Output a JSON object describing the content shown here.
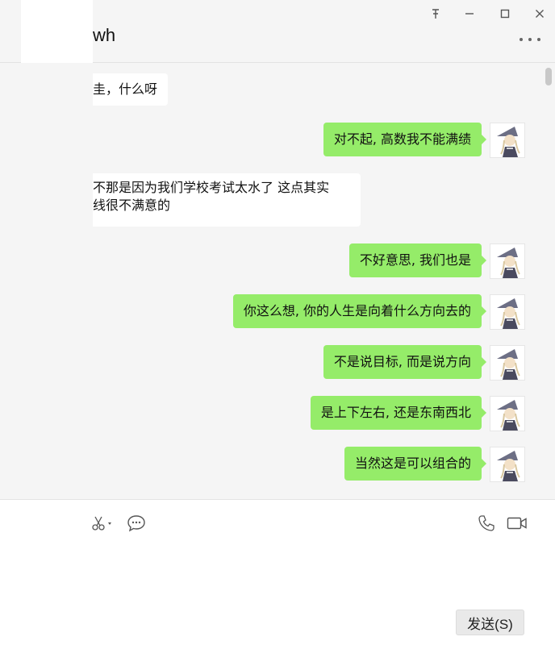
{
  "window": {
    "title": "wh",
    "controls": [
      "pin-icon",
      "minimize-icon",
      "maximize-icon",
      "close-icon"
    ]
  },
  "messages": [
    {
      "side": "in",
      "text": "圭，什么呀"
    },
    {
      "side": "out",
      "text": "对不起, 高数我不能满绩"
    },
    {
      "side": "in",
      "line1": "不那是因为我们学校考试太水了 这点其实",
      "line2": "线很不满意的"
    },
    {
      "side": "out",
      "text": "不好意思, 我们也是"
    },
    {
      "side": "out",
      "text": "你这么想, 你的人生是向着什么方向去的"
    },
    {
      "side": "out",
      "text": "不是说目标, 而是说方向"
    },
    {
      "side": "out",
      "text": "是上下左右, 还是东南西北"
    },
    {
      "side": "out",
      "text": "当然这是可以组合的"
    }
  ],
  "toolbar": {
    "left_icons": [
      "scissors-icon",
      "chat-bubble-icon"
    ],
    "right_icons": [
      "phone-icon",
      "video-icon"
    ]
  },
  "input": {
    "value": "",
    "send_label": "发送(S)"
  },
  "colors": {
    "outgoing_bubble": "#95ec69",
    "incoming_bubble": "#ffffff",
    "background": "#f5f5f5"
  }
}
